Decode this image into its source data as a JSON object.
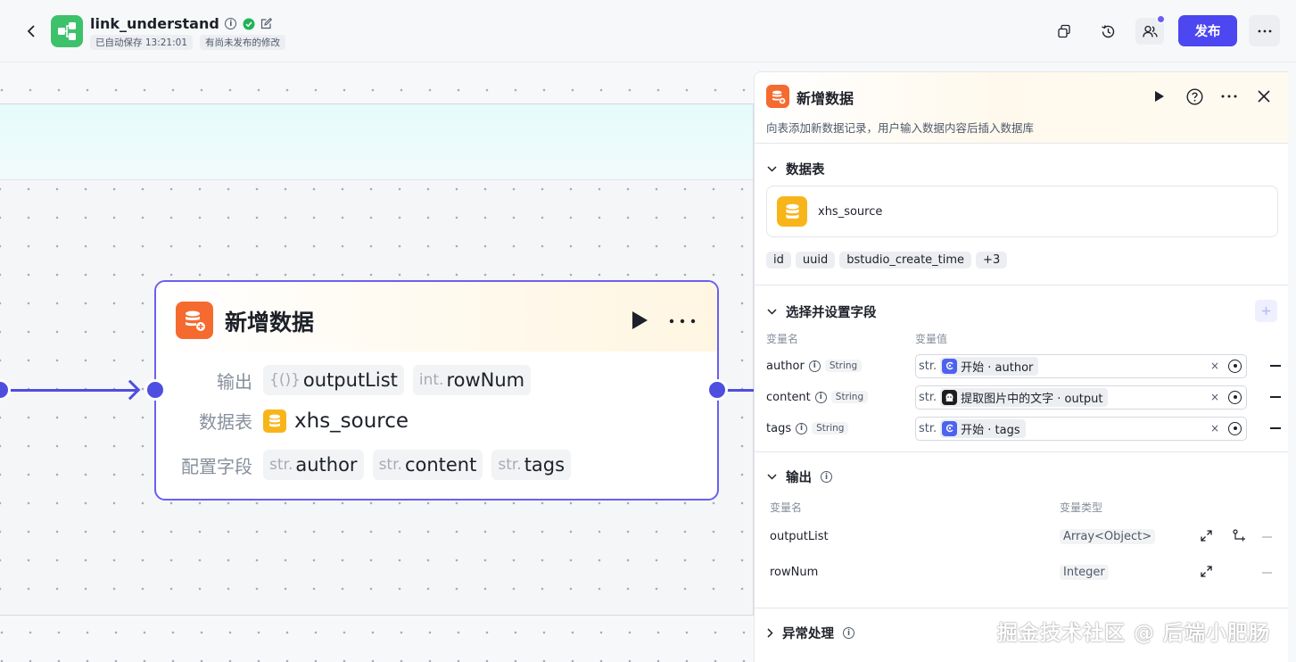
{
  "header": {
    "app_name": "link_understand",
    "autosave": "已自动保存 13:21:01",
    "unpublished": "有尚未发布的修改",
    "publish_label": "发布"
  },
  "canvas": {
    "node": {
      "title": "新增数据",
      "output_label": "输出",
      "outputs": [
        {
          "prefix": "{()}",
          "name": "outputList"
        },
        {
          "prefix": "int.",
          "name": "rowNum"
        }
      ],
      "table_label": "数据表",
      "table_name": "xhs_source",
      "fields_label": "配置字段",
      "fields": [
        {
          "prefix": "str.",
          "name": "author"
        },
        {
          "prefix": "str.",
          "name": "content"
        },
        {
          "prefix": "str.",
          "name": "tags"
        }
      ]
    }
  },
  "panel": {
    "title": "新增数据",
    "description": "向表添加新数据记录，用户输入数据内容后插入数据库",
    "table_section": "数据表",
    "table_name": "xhs_source",
    "table_fields": [
      "id",
      "uuid",
      "bstudio_create_time",
      "+3"
    ],
    "fields_section": "选择并设置字段",
    "col_var_name": "变量名",
    "col_var_value": "变量值",
    "field_rows": [
      {
        "name": "author",
        "type": "String",
        "prefix": "str.",
        "source": "开始 · author",
        "source_icon": "start-icon"
      },
      {
        "name": "content",
        "type": "String",
        "prefix": "str.",
        "source": "提取图片中的文字 · output",
        "source_icon": "ai-node-icon"
      },
      {
        "name": "tags",
        "type": "String",
        "prefix": "str.",
        "source": "开始 · tags",
        "source_icon": "start-icon"
      }
    ],
    "output_section": "输出",
    "out_col_name": "变量名",
    "out_col_type": "变量类型",
    "outputs": [
      {
        "name": "outputList",
        "type": "Array<Object>"
      },
      {
        "name": "rowNum",
        "type": "Integer"
      }
    ],
    "error_section": "异常处理"
  },
  "watermark": "掘金技术社区 @ 后端小肥肠",
  "colors": {
    "primary": "#4c47f0",
    "edge": "#4e4ee0",
    "node_icon": "#f56a2f",
    "db_icon": "#f8b51a",
    "app_logo": "#3ec16b"
  }
}
